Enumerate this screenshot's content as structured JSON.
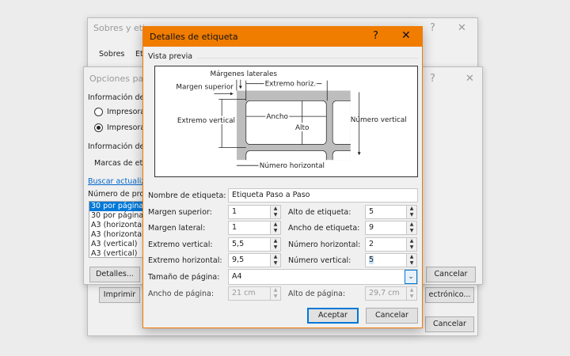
{
  "back_dialog": {
    "title": "Sobres y etiq",
    "help": "?",
    "close": "✕",
    "tabs": [
      "Sobres",
      "Et"
    ],
    "print_button": "Imprimir",
    "electronic_button": "ectrónico...",
    "cancel_button": "Cancelar"
  },
  "options_dialog": {
    "title": "Opciones para",
    "help": "?",
    "close": "✕",
    "section_printer": "Información de",
    "radio_1": "Impresora",
    "radio_2": "Impresora",
    "radio_selected": 2,
    "section_label": "Información de",
    "label_vendor": "Marcas de eti",
    "link_updates": "Buscar actualiza",
    "product_number": "Número de pro",
    "product_list": [
      "30 por página",
      "30 por página",
      "A3 (horizontal)",
      "A3 (horizontal)",
      "A3 (vertical)",
      "A3 (vertical)"
    ],
    "details_button": "Detalles...",
    "cancel_button": "Cancelar"
  },
  "label_details": {
    "title": "Detalles de etiqueta",
    "help": "?",
    "close": "✕",
    "title_color": "#f07c00",
    "preview_label": "Vista previa",
    "preview": {
      "lateral_margins": "Márgenes laterales",
      "top_margin": "Margen superior",
      "horizontal_pitch": "Extremo horiz.",
      "vertical_pitch": "Extremo vertical",
      "width": "Ancho",
      "height": "Alto",
      "number_down": "Número vertical",
      "number_across": "Número horizontal"
    },
    "name_label": "Nombre de etiqueta:",
    "name_value": "Etiqueta Paso a Paso",
    "top_margin_label": "Margen superior:",
    "top_margin_value": "1",
    "side_margin_label": "Margen lateral:",
    "side_margin_value": "1",
    "vertical_pitch_label": "Extremo vertical:",
    "vertical_pitch_value": "5,5",
    "horizontal_pitch_label": "Extremo horizontal:",
    "horizontal_pitch_value": "9,5",
    "label_height_label": "Alto de etiqueta:",
    "label_height_value": "5",
    "label_width_label": "Ancho de etiqueta:",
    "label_width_value": "9",
    "number_across_label": "Número horizontal:",
    "number_across_value": "2",
    "number_down_label": "Número vertical:",
    "number_down_value": "5",
    "page_size_label": "Tamaño de página:",
    "page_size_value": "A4",
    "page_width_label": "Ancho de página:",
    "page_width_value": "21 cm",
    "page_height_label": "Alto de página:",
    "page_height_value": "29,7 cm",
    "ok_button": "Aceptar",
    "cancel_button": "Cancelar"
  }
}
